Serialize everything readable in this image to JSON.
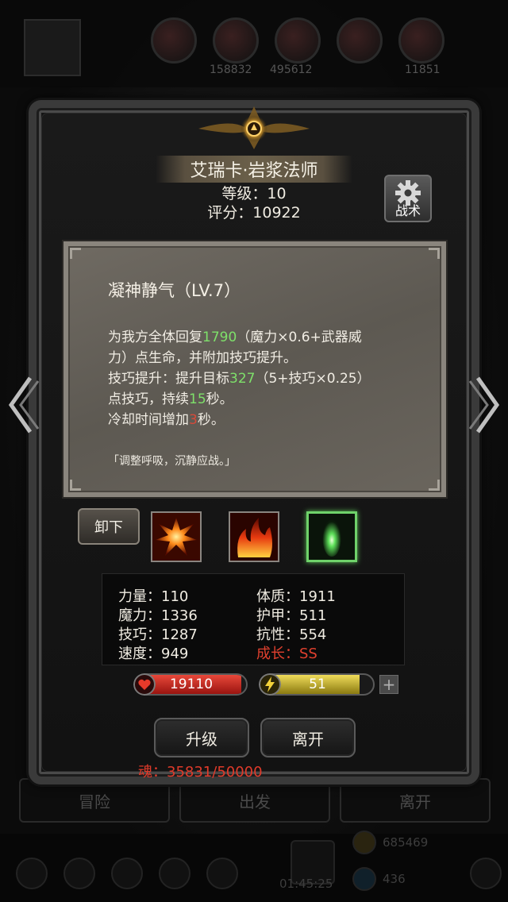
{
  "background": {
    "top_counts": [
      "158832",
      "495612",
      "11851"
    ],
    "bottom_buttons": [
      "冒险",
      "出发",
      "离开"
    ],
    "dock_counts": [
      "685469",
      "436"
    ],
    "dock_timer": "01:45:25"
  },
  "hero": {
    "name": "艾瑞卡·岩浆法师",
    "level_text": "等级：10",
    "score_text": "评分：10922"
  },
  "tactics": {
    "label": "战术"
  },
  "skill": {
    "title": "凝神静气（LV.7）",
    "desc": {
      "l1a": "为我方全体回复",
      "l1v": "1790",
      "l1b": "（魔力×0.6+武器威",
      "l2": "力）点生命，并附加技巧提升。",
      "l3a": "技巧提升：提升目标",
      "l3v": "327",
      "l3b": "（5+技巧×0.25）",
      "l4a": "点技巧，持续",
      "l4v": "15",
      "l4b": "秒。",
      "l5a": "冷却时间增加",
      "l5v": "3",
      "l5b": "秒。"
    },
    "quote": "「调整呼吸，沉静应战。」"
  },
  "unequip_label": "卸下",
  "skill_slots": [
    {
      "icon": "fire-burst-icon",
      "selected": false
    },
    {
      "icon": "flame-icon",
      "selected": false
    },
    {
      "icon": "green-spirit-icon",
      "selected": true
    }
  ],
  "stats": {
    "strength": "力量：110",
    "magic": "魔力：1336",
    "skill": "技巧：1287",
    "speed": "速度：949",
    "constitution": "体质：1911",
    "armor": "护甲：511",
    "resistance": "抗性：554",
    "growth": "成长：SS"
  },
  "hp": {
    "value": "19110",
    "fill": 0.96
  },
  "energy": {
    "value": "51",
    "fill": 0.88
  },
  "buttons": {
    "upgrade": "升级",
    "leave": "离开"
  },
  "soul": "魂：35831/50000",
  "colors": {
    "highlight_green": "#7ee06a",
    "warning_red": "#d64a3a",
    "hp_red": "#c0221a",
    "energy_yellow": "#d8c23a"
  }
}
